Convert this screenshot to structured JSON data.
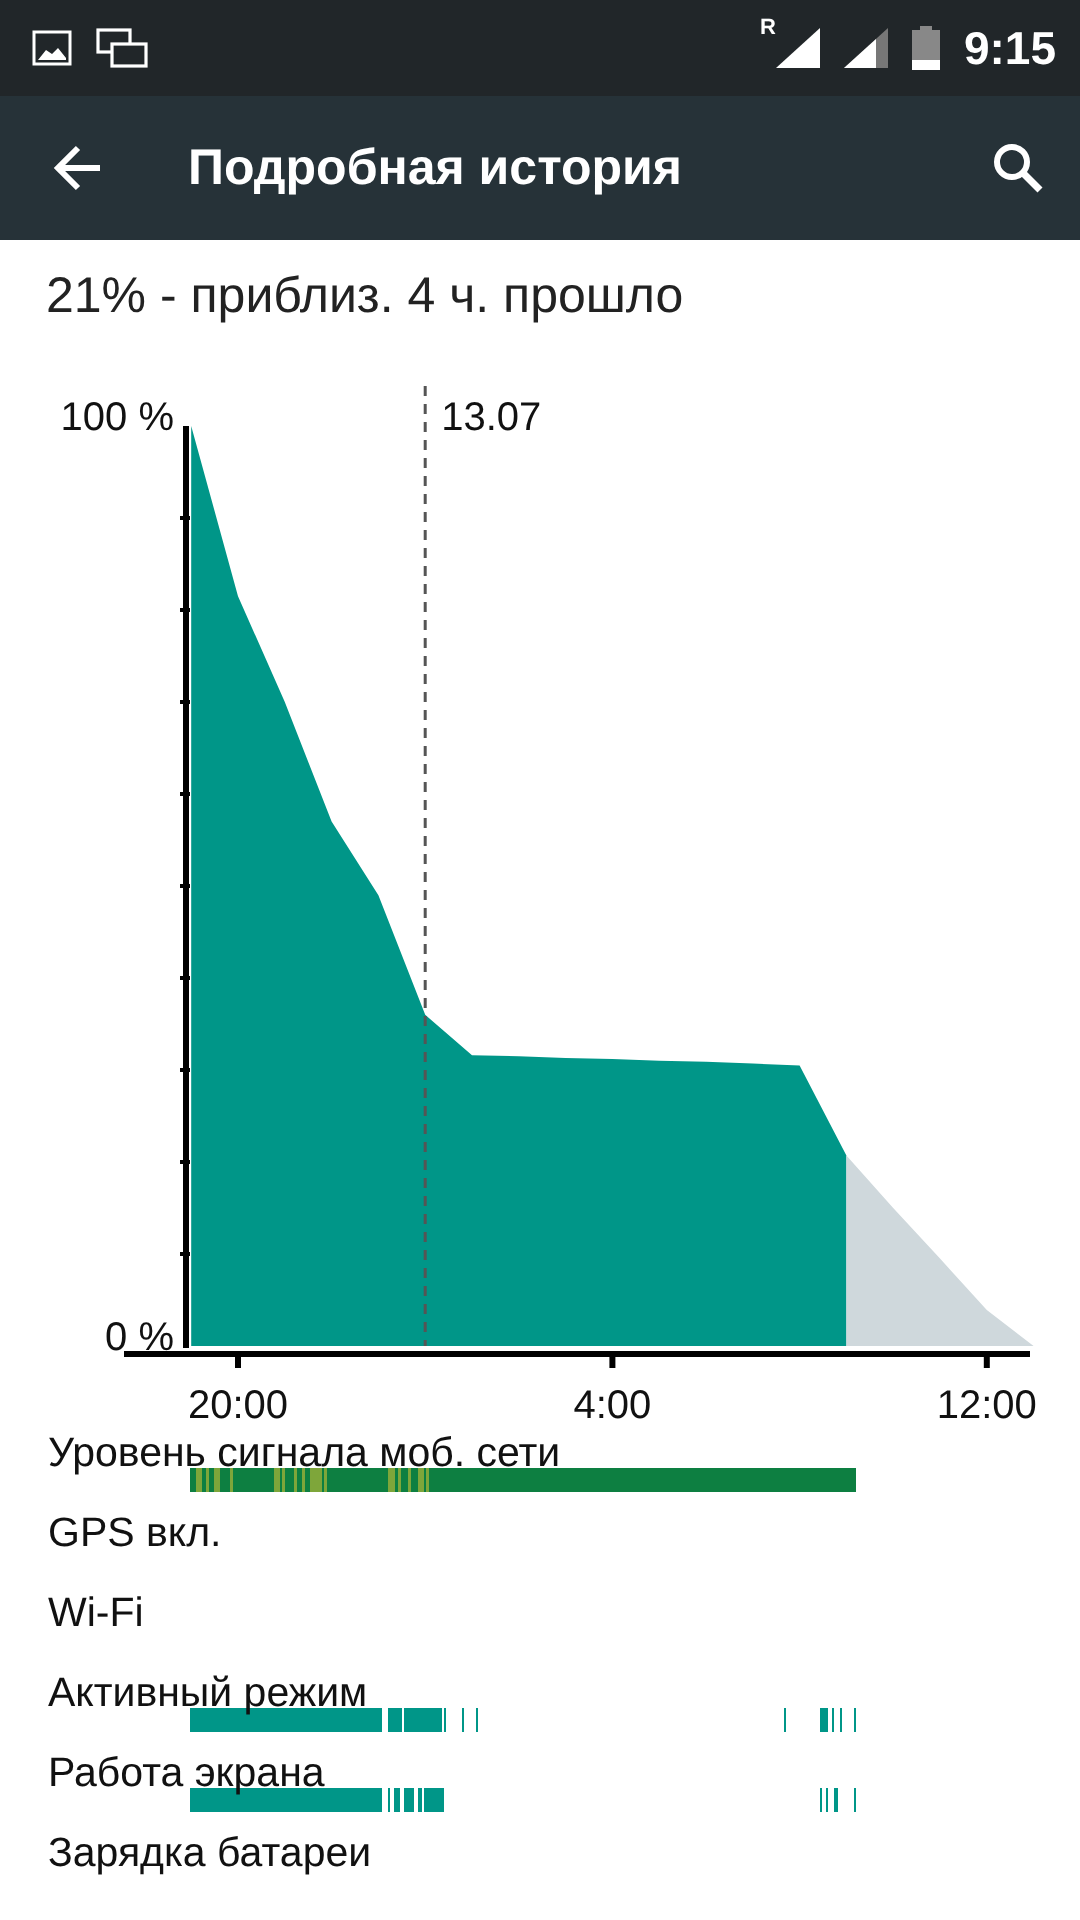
{
  "status_bar": {
    "roaming": "R",
    "time": "9:15"
  },
  "toolbar": {
    "title": "Подробная история"
  },
  "summary": "21% - приблиз. 4 ч. прошло",
  "battery_chart": {
    "chart_data": {
      "type": "area",
      "categories": [
        null,
        "20:00",
        null,
        null,
        null,
        null,
        null,
        null,
        null,
        "4:00",
        null,
        null,
        null,
        null,
        null,
        null,
        null,
        "12:00",
        null
      ],
      "series": [
        {
          "color": "#009688",
          "values": [
            100,
            81.5,
            70,
            57,
            49,
            36,
            31.6,
            31.5,
            31.3,
            31.2,
            31,
            30.9,
            30.7,
            30.5,
            20.7,
            null,
            null,
            null,
            null
          ]
        },
        {
          "color": "#cfd8dc",
          "values": [
            null,
            null,
            null,
            null,
            null,
            null,
            null,
            null,
            null,
            null,
            null,
            null,
            null,
            null,
            20.7,
            15,
            9.5,
            3.9,
            0
          ]
        }
      ],
      "ylim": [
        0,
        100
      ],
      "yticks": [
        {
          "value": 0,
          "label": "0 %"
        },
        {
          "value": 100,
          "label": "100 %"
        }
      ],
      "annotations": [
        "13.07"
      ]
    }
  },
  "rows": [
    {
      "label": "Уровень сигнала моб. сети",
      "kind": "signal"
    },
    {
      "label": "GPS вкл.",
      "kind": "empty"
    },
    {
      "label": "Wi-Fi",
      "kind": "empty"
    },
    {
      "label": "Активный режим",
      "kind": "activity"
    },
    {
      "label": "Работа экрана",
      "kind": "screen"
    },
    {
      "label": "Зарядка батареи",
      "kind": "empty"
    }
  ]
}
